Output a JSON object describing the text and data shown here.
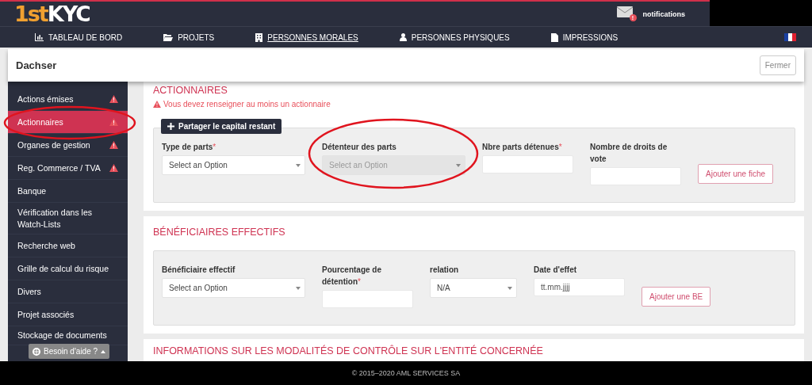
{
  "logo": {
    "prefix": "1st",
    "name": "KYC"
  },
  "notifications": {
    "label": "notifications",
    "badge": "!"
  },
  "nav": [
    {
      "label": "TABLEAU DE BORD",
      "kind": "chart",
      "selected": false
    },
    {
      "label": "PROJETS",
      "kind": "folder",
      "selected": false
    },
    {
      "label": "PERSONNES MORALES",
      "kind": "building",
      "selected": true
    },
    {
      "label": "PERSONNES PHYSIQUES",
      "kind": "person",
      "selected": false
    },
    {
      "label": "IMPRESSIONS",
      "kind": "file",
      "selected": false
    }
  ],
  "page": {
    "title": "Dachser",
    "close_button": "Fermer"
  },
  "sidebar": {
    "items": [
      {
        "label": "Actions émises",
        "selected": false,
        "warning": true
      },
      {
        "label": "Actionnaires",
        "selected": true,
        "warning": true
      },
      {
        "label": "Organes de gestion",
        "selected": false,
        "warning": true
      },
      {
        "label": "Reg. Commerce / TVA",
        "selected": false,
        "warning": true
      },
      {
        "label": "Banque",
        "selected": false,
        "warning": false
      },
      {
        "label": "Vérification dans les Watch-Lists",
        "selected": false,
        "warning": false
      },
      {
        "label": "Recherche web",
        "selected": false,
        "warning": false
      },
      {
        "label": "Grille de calcul du risque",
        "selected": false,
        "warning": false
      },
      {
        "label": "Divers",
        "selected": false,
        "warning": false
      },
      {
        "label": "Projet associés",
        "selected": false,
        "warning": false
      },
      {
        "label": "Stockage de documents",
        "selected": false,
        "warning": false
      }
    ],
    "help_button": "Besoin d'aide ?"
  },
  "sections": [
    {
      "title": "ACTIONNAIRES",
      "warning": "Vous devez renseigner au moins un actionnaire",
      "action_button": "Partager le capital restant",
      "fields": [
        {
          "kind": "select",
          "label": "Type de parts",
          "required_mark": "*",
          "placeholder": "Select an Option",
          "disabled": false
        },
        {
          "kind": "select",
          "label": "Détenteur des parts",
          "placeholder": "Select an Option",
          "disabled": true
        },
        {
          "kind": "input",
          "label": "Nbre parts détenues",
          "required_mark": "*",
          "disabled": false
        },
        {
          "kind": "input",
          "label": "Nombre de droits de vote",
          "disabled": false
        }
      ],
      "add_button": "Ajouter une fiche"
    },
    {
      "title": "BÉNÉFICIAIRES EFFECTIFS",
      "fields": [
        {
          "kind": "select",
          "label": "Bénéficiaire effectif",
          "placeholder": "Select an Option",
          "disabled": false
        },
        {
          "kind": "input",
          "label": "Pourcentage de détention",
          "required_mark": "*",
          "disabled": false
        },
        {
          "kind": "select",
          "label": "relation",
          "value": "N/A",
          "disabled": false
        },
        {
          "kind": "input",
          "label": "Date d'effet",
          "placeholder": "tt.mm.jjjj",
          "disabled": false
        }
      ],
      "add_button": "Ajouter une BE"
    },
    {
      "title": "INFORMATIONS SUR LES MODALITÉS DE CONTRÔLE SUR L'ENTITÉ CONCERNÉE"
    }
  ],
  "footer": "© 2015–2020 AML SERVICES SA"
}
